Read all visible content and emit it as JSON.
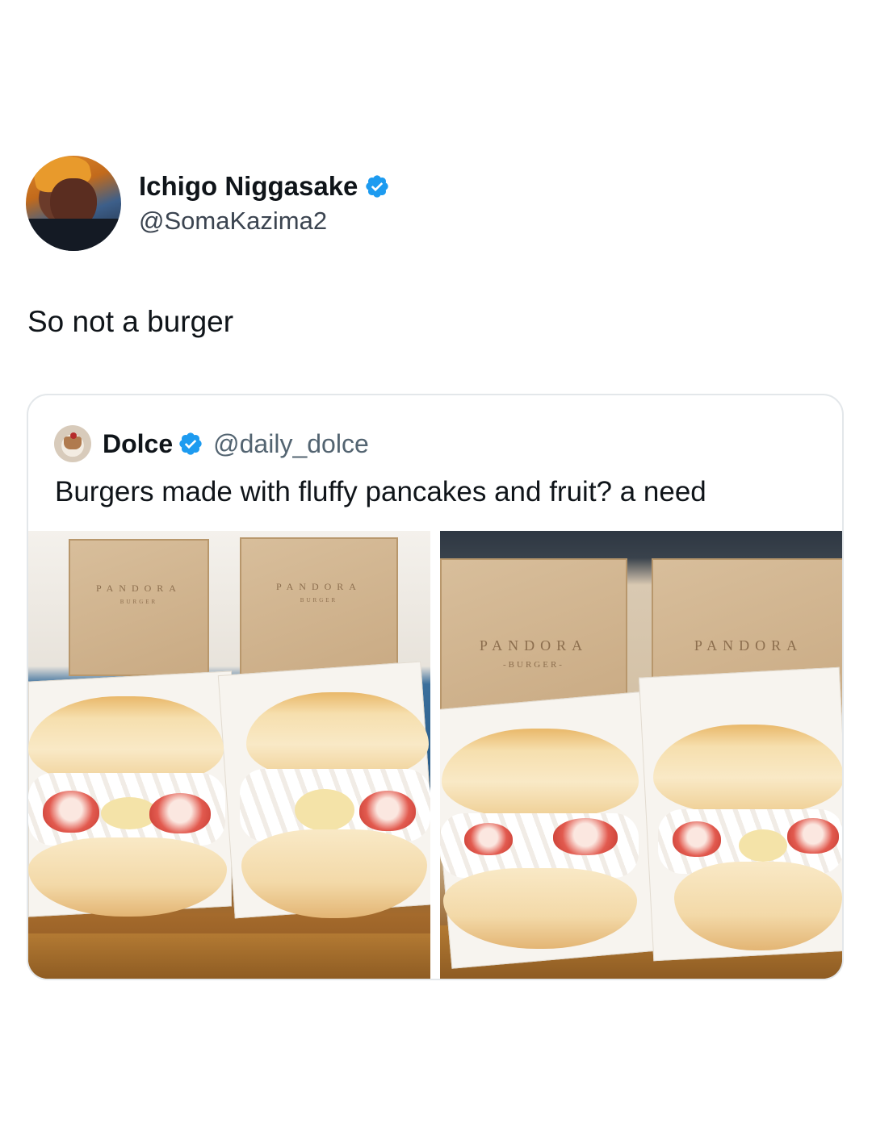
{
  "tweet": {
    "display_name": "Ichigo Niggasake",
    "handle": "@SomaKazima2",
    "text": "So not a burger",
    "verified_icon": "verified-badge-icon"
  },
  "quoted_tweet": {
    "display_name": "Dolce",
    "handle": "@daily_dolce",
    "text": "Burgers made with fluffy pancakes and fruit? a need",
    "verified_icon": "verified-badge-icon",
    "photos": [
      {
        "box_brand": "PANDORA",
        "box_sub": "BURGER"
      },
      {
        "box_brand": "PANDORA",
        "box_sub": "-BURGER-"
      }
    ]
  },
  "colors": {
    "verified": "#1d9bf0",
    "text_primary": "#0f1419",
    "text_secondary": "#536471",
    "border": "#e3e7ea"
  }
}
